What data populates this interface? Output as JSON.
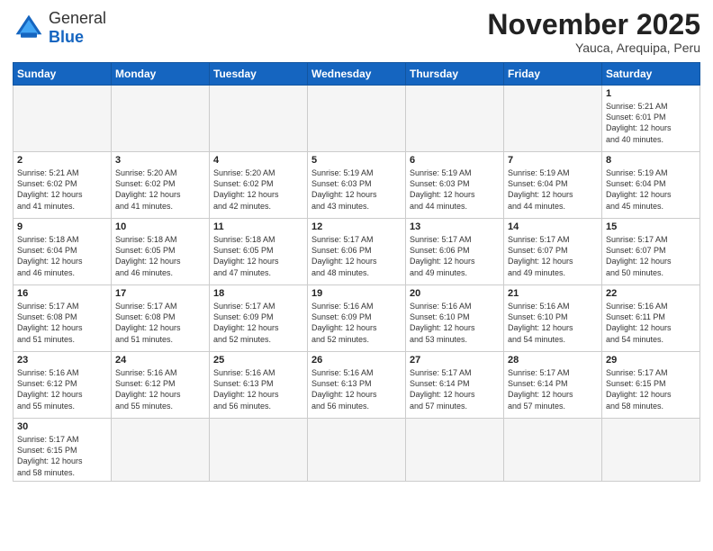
{
  "logo": {
    "text_general": "General",
    "text_blue": "Blue"
  },
  "header": {
    "month": "November 2025",
    "location": "Yauca, Arequipa, Peru"
  },
  "days_of_week": [
    "Sunday",
    "Monday",
    "Tuesday",
    "Wednesday",
    "Thursday",
    "Friday",
    "Saturday"
  ],
  "weeks": [
    [
      {
        "day": "",
        "info": ""
      },
      {
        "day": "",
        "info": ""
      },
      {
        "day": "",
        "info": ""
      },
      {
        "day": "",
        "info": ""
      },
      {
        "day": "",
        "info": ""
      },
      {
        "day": "",
        "info": ""
      },
      {
        "day": "1",
        "info": "Sunrise: 5:21 AM\nSunset: 6:01 PM\nDaylight: 12 hours\nand 40 minutes."
      }
    ],
    [
      {
        "day": "2",
        "info": "Sunrise: 5:21 AM\nSunset: 6:02 PM\nDaylight: 12 hours\nand 41 minutes."
      },
      {
        "day": "3",
        "info": "Sunrise: 5:20 AM\nSunset: 6:02 PM\nDaylight: 12 hours\nand 41 minutes."
      },
      {
        "day": "4",
        "info": "Sunrise: 5:20 AM\nSunset: 6:02 PM\nDaylight: 12 hours\nand 42 minutes."
      },
      {
        "day": "5",
        "info": "Sunrise: 5:19 AM\nSunset: 6:03 PM\nDaylight: 12 hours\nand 43 minutes."
      },
      {
        "day": "6",
        "info": "Sunrise: 5:19 AM\nSunset: 6:03 PM\nDaylight: 12 hours\nand 44 minutes."
      },
      {
        "day": "7",
        "info": "Sunrise: 5:19 AM\nSunset: 6:04 PM\nDaylight: 12 hours\nand 44 minutes."
      },
      {
        "day": "8",
        "info": "Sunrise: 5:19 AM\nSunset: 6:04 PM\nDaylight: 12 hours\nand 45 minutes."
      }
    ],
    [
      {
        "day": "9",
        "info": "Sunrise: 5:18 AM\nSunset: 6:04 PM\nDaylight: 12 hours\nand 46 minutes."
      },
      {
        "day": "10",
        "info": "Sunrise: 5:18 AM\nSunset: 6:05 PM\nDaylight: 12 hours\nand 46 minutes."
      },
      {
        "day": "11",
        "info": "Sunrise: 5:18 AM\nSunset: 6:05 PM\nDaylight: 12 hours\nand 47 minutes."
      },
      {
        "day": "12",
        "info": "Sunrise: 5:17 AM\nSunset: 6:06 PM\nDaylight: 12 hours\nand 48 minutes."
      },
      {
        "day": "13",
        "info": "Sunrise: 5:17 AM\nSunset: 6:06 PM\nDaylight: 12 hours\nand 49 minutes."
      },
      {
        "day": "14",
        "info": "Sunrise: 5:17 AM\nSunset: 6:07 PM\nDaylight: 12 hours\nand 49 minutes."
      },
      {
        "day": "15",
        "info": "Sunrise: 5:17 AM\nSunset: 6:07 PM\nDaylight: 12 hours\nand 50 minutes."
      }
    ],
    [
      {
        "day": "16",
        "info": "Sunrise: 5:17 AM\nSunset: 6:08 PM\nDaylight: 12 hours\nand 51 minutes."
      },
      {
        "day": "17",
        "info": "Sunrise: 5:17 AM\nSunset: 6:08 PM\nDaylight: 12 hours\nand 51 minutes."
      },
      {
        "day": "18",
        "info": "Sunrise: 5:17 AM\nSunset: 6:09 PM\nDaylight: 12 hours\nand 52 minutes."
      },
      {
        "day": "19",
        "info": "Sunrise: 5:16 AM\nSunset: 6:09 PM\nDaylight: 12 hours\nand 52 minutes."
      },
      {
        "day": "20",
        "info": "Sunrise: 5:16 AM\nSunset: 6:10 PM\nDaylight: 12 hours\nand 53 minutes."
      },
      {
        "day": "21",
        "info": "Sunrise: 5:16 AM\nSunset: 6:10 PM\nDaylight: 12 hours\nand 54 minutes."
      },
      {
        "day": "22",
        "info": "Sunrise: 5:16 AM\nSunset: 6:11 PM\nDaylight: 12 hours\nand 54 minutes."
      }
    ],
    [
      {
        "day": "23",
        "info": "Sunrise: 5:16 AM\nSunset: 6:12 PM\nDaylight: 12 hours\nand 55 minutes."
      },
      {
        "day": "24",
        "info": "Sunrise: 5:16 AM\nSunset: 6:12 PM\nDaylight: 12 hours\nand 55 minutes."
      },
      {
        "day": "25",
        "info": "Sunrise: 5:16 AM\nSunset: 6:13 PM\nDaylight: 12 hours\nand 56 minutes."
      },
      {
        "day": "26",
        "info": "Sunrise: 5:16 AM\nSunset: 6:13 PM\nDaylight: 12 hours\nand 56 minutes."
      },
      {
        "day": "27",
        "info": "Sunrise: 5:17 AM\nSunset: 6:14 PM\nDaylight: 12 hours\nand 57 minutes."
      },
      {
        "day": "28",
        "info": "Sunrise: 5:17 AM\nSunset: 6:14 PM\nDaylight: 12 hours\nand 57 minutes."
      },
      {
        "day": "29",
        "info": "Sunrise: 5:17 AM\nSunset: 6:15 PM\nDaylight: 12 hours\nand 58 minutes."
      }
    ],
    [
      {
        "day": "30",
        "info": "Sunrise: 5:17 AM\nSunset: 6:15 PM\nDaylight: 12 hours\nand 58 minutes."
      },
      {
        "day": "",
        "info": ""
      },
      {
        "day": "",
        "info": ""
      },
      {
        "day": "",
        "info": ""
      },
      {
        "day": "",
        "info": ""
      },
      {
        "day": "",
        "info": ""
      },
      {
        "day": "",
        "info": ""
      }
    ]
  ]
}
